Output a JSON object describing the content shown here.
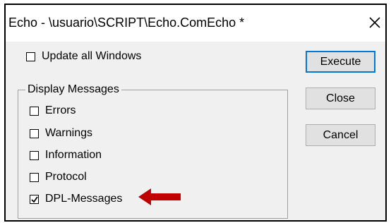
{
  "window": {
    "title": "Echo - \\usuario\\SCRIPT\\Echo.ComEcho *",
    "close_glyph": "close-icon"
  },
  "options": {
    "update_all_windows": {
      "label": "Update all Windows",
      "checked": false
    }
  },
  "display_messages": {
    "title": "Display Messages",
    "items": [
      {
        "label": "Errors",
        "checked": false
      },
      {
        "label": "Warnings",
        "checked": false
      },
      {
        "label": "Information",
        "checked": false
      },
      {
        "label": "Protocol",
        "checked": false
      },
      {
        "label": "DPL-Messages",
        "checked": true
      }
    ]
  },
  "buttons": {
    "execute": "Execute",
    "close": "Close",
    "cancel": "Cancel"
  },
  "colors": {
    "annotation_arrow": "#c00000",
    "default_button_border": "#0078d7"
  }
}
